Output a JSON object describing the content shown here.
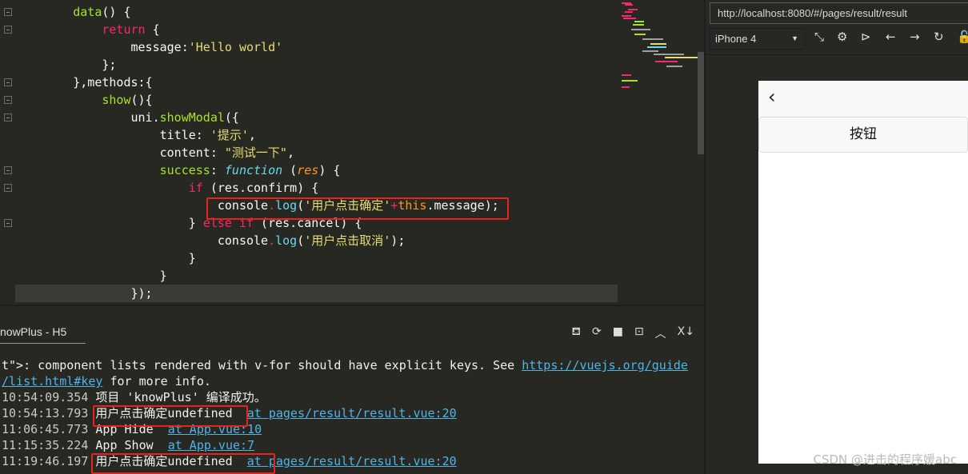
{
  "editor": {
    "lines": [
      [
        [
          "        ",
          "plain"
        ],
        [
          "data",
          "fn"
        ],
        [
          "() {",
          "plain"
        ]
      ],
      [
        [
          "            ",
          "plain"
        ],
        [
          "return",
          "kw"
        ],
        [
          " {",
          "plain"
        ]
      ],
      [
        [
          "                message:",
          "plain"
        ],
        [
          "'Hello world'",
          "str"
        ]
      ],
      [
        [
          "            };",
          "plain"
        ]
      ],
      [
        [
          "        },methods:{",
          "plain"
        ]
      ],
      [
        [
          "            ",
          "plain"
        ],
        [
          "show",
          "fn"
        ],
        [
          "(){",
          "plain"
        ]
      ],
      [
        [
          "                uni.",
          "plain"
        ],
        [
          "showModal",
          "fn"
        ],
        [
          "({",
          "plain"
        ]
      ],
      [
        [
          "                    title: ",
          "plain"
        ],
        [
          "'提示'",
          "str"
        ],
        [
          ",",
          "plain"
        ]
      ],
      [
        [
          "                    content: ",
          "plain"
        ],
        [
          "\"测试一下\"",
          "str"
        ],
        [
          ",",
          "plain"
        ]
      ],
      [
        [
          "                    ",
          "plain"
        ],
        [
          "success",
          "prop"
        ],
        [
          ": ",
          "plain"
        ],
        [
          "function",
          "ital"
        ],
        [
          " (",
          "plain"
        ],
        [
          "res",
          "param"
        ],
        [
          ") {",
          "plain"
        ]
      ],
      [
        [
          "                        ",
          "plain"
        ],
        [
          "if",
          "kw"
        ],
        [
          " (res.confirm) {",
          "plain"
        ]
      ],
      [
        [
          "                            console",
          "plain"
        ],
        [
          ".",
          "kw"
        ],
        [
          "log",
          "call"
        ],
        [
          "(",
          "plain"
        ],
        [
          "'用户点击确定'",
          "str"
        ],
        [
          "+",
          "kw"
        ],
        [
          "this",
          "this"
        ],
        [
          ".message);",
          "plain"
        ]
      ],
      [
        [
          "                        } ",
          "plain"
        ],
        [
          "else if",
          "kw"
        ],
        [
          " (res.cancel) {",
          "plain"
        ]
      ],
      [
        [
          "                            console",
          "plain"
        ],
        [
          ".",
          "kw"
        ],
        [
          "log",
          "call"
        ],
        [
          "(",
          "plain"
        ],
        [
          "'用户点击取消'",
          "str"
        ],
        [
          ");",
          "plain"
        ]
      ],
      [
        [
          "                        }",
          "plain"
        ]
      ],
      [
        [
          "                    }",
          "plain"
        ]
      ],
      [
        [
          "                });",
          "plain"
        ]
      ]
    ]
  },
  "console": {
    "tab_label": "nowPlus - H5",
    "icons": [
      "bug-icon",
      "run-icon",
      "stop-icon",
      "terminal-icon",
      "collapse-icon",
      "clear-icon"
    ],
    "lines": [
      {
        "ts": "",
        "text": "t\">: component lists rendered with v-for should have explicit keys. See ",
        "link": "https://vuejs.org/guide"
      },
      {
        "ts": "",
        "text": "",
        "link": "/list.html#key",
        "after": " for more info."
      },
      {
        "ts": "10:54:09.354 ",
        "text": "项目 'knowPlus' 编译成功。",
        "link": ""
      },
      {
        "ts": "10:54:13.793 ",
        "text": "用户点击确定undefined  ",
        "link": "at pages/result/result.vue:20"
      },
      {
        "ts": "11:06:45.773 ",
        "text": "App Hide  ",
        "link": "at App.vue:10"
      },
      {
        "ts": "11:15:35.224 ",
        "text": "App Show  ",
        "link": "at App.vue:7"
      },
      {
        "ts": "11:19:46.197 ",
        "text": "用户点击确定undefined  ",
        "link": "at pages/result/result.vue:20"
      }
    ]
  },
  "preview": {
    "url": "http://localhost:8080/#/pages/result/result",
    "device": "iPhone 4",
    "toolbar_icons": [
      "screenshot-icon",
      "gear-icon",
      "terminal-icon",
      "back-icon",
      "forward-icon",
      "refresh-icon",
      "lock-icon"
    ],
    "button_label": "按钮",
    "watermark": "CSDN @进击的程序媛abc"
  },
  "colors": {
    "highlight_box": "#e8231f",
    "link": "#4fb4e8",
    "editor_bg": "#272822"
  }
}
